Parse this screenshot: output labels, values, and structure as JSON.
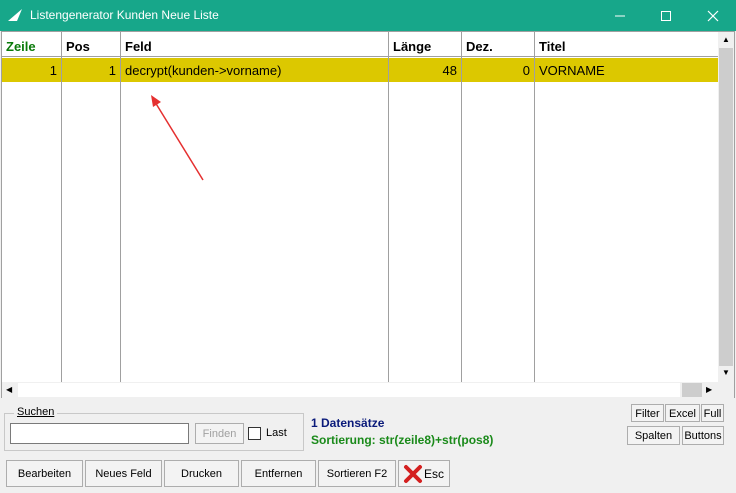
{
  "window": {
    "title": "Listengenerator Kunden Neue Liste"
  },
  "grid": {
    "columns": [
      "Zeile",
      "Pos",
      "Feld",
      "Länge",
      "Dez.",
      "Titel"
    ],
    "rows": [
      {
        "zeile": "1",
        "pos": "1",
        "feld": "decrypt(kunden->vorname)",
        "laenge": "48",
        "dez": "0",
        "titel": "VORNAME"
      }
    ]
  },
  "search": {
    "legend": "Suchen",
    "value": "",
    "find_label": "Finden",
    "last_label": "Last"
  },
  "status": {
    "count": "1 Datensätze",
    "sort": "Sortierung: str(zeile8)+str(pos8)"
  },
  "side_buttons": {
    "filter": "Filter",
    "excel": "Excel",
    "full": "Full",
    "spalten": "Spalten",
    "buttons": "Buttons"
  },
  "bottom_buttons": {
    "bearbeiten": "Bearbeiten",
    "neues_feld": "Neues Feld",
    "drucken": "Drucken",
    "entfernen": "Entfernen",
    "sortieren": "Sortieren F2",
    "esc": "Esc"
  },
  "colors": {
    "titlebar": "#17a78a",
    "selected_row": "#dcc800",
    "active_header": "#0a7a0a"
  }
}
